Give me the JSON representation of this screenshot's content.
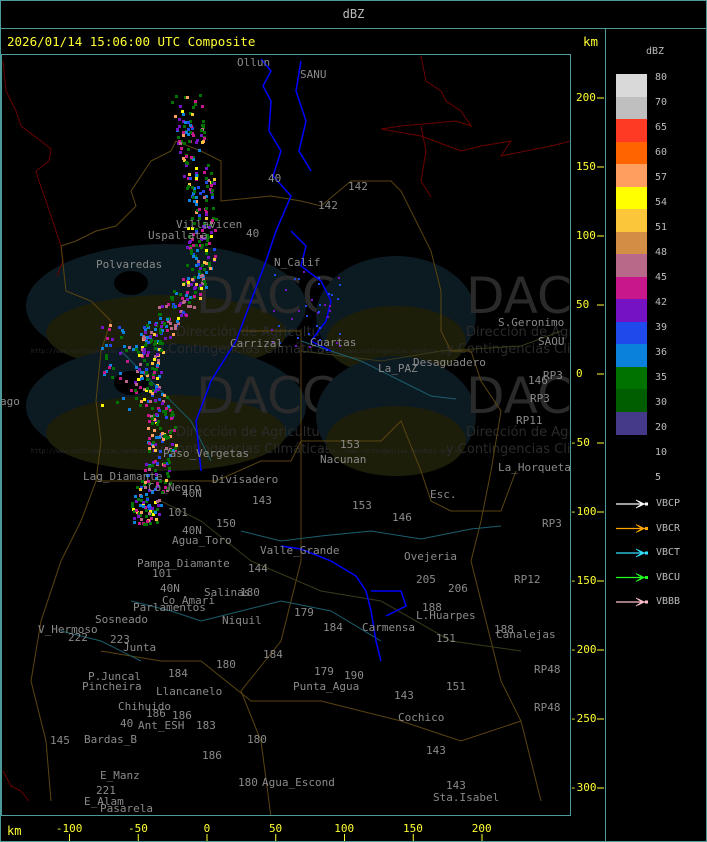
{
  "header": {
    "title": "dBZ"
  },
  "map": {
    "title": "2026/01/14 15:06:00 UTC Composite",
    "unit_top": "km",
    "unit_bottom": "km",
    "x_ticks": [
      "-100",
      "-50",
      "0",
      "50",
      "100",
      "150",
      "200"
    ],
    "y_ticks": [
      "200",
      "150",
      "100",
      "50",
      "0",
      "-50",
      "-100",
      "-150",
      "-200",
      "-250",
      "-300"
    ],
    "watermark": {
      "name": "DACC",
      "line1": "Dirección de Agricultura",
      "line2": "y Contingencias Climáticas",
      "url": "http://www.contingencias.mendoza.gov.ar"
    },
    "places": [
      "Ollun",
      "SANU",
      "Uspallata",
      "Villavicen",
      "Polvaredas",
      "N_Calif",
      "142",
      "142",
      "40",
      "40",
      "Carrizal",
      "Cuartas",
      "La_PAZ",
      "Desaguadero",
      "S.Geronimo",
      "SAOU",
      "RP3",
      "146",
      "RP3",
      "RP11",
      "153",
      "Nacunan",
      "La_Horqueta",
      "Esc.",
      "153",
      "146",
      "Divisadero",
      "Co_Negro",
      "Lag_Diamante",
      "Paso_Vergetas",
      "40N",
      "101",
      "143",
      "150",
      "40N",
      "Agua_Toro",
      "Pampa_Diamante",
      "101",
      "Valle_Grande",
      "144",
      "Salinas",
      "180",
      "40N",
      "Co_Amari",
      "Parlamentos",
      "Sosneado",
      "Niquil",
      "179",
      "184",
      "Carmensa",
      "Ovejeria",
      "205",
      "206",
      "188",
      "L.Huarpes",
      "151",
      "188",
      "Canalejas",
      "RP12",
      "RP3",
      "RP48",
      "RP48",
      "V_Hermoso",
      "222",
      "223",
      "Junta",
      "P.Juncal",
      "Pincheira",
      "184",
      "180",
      "184",
      "179",
      "190",
      "Punta_Agua",
      "Llancanelo",
      "151",
      "143",
      "Cochico",
      "Chihuido",
      "186",
      "186",
      "183",
      "40",
      "Ant_ESH",
      "145",
      "Bardas_B",
      "180",
      "186",
      "143",
      "E_Manz",
      "180",
      "Agua_Escond",
      "143",
      "Sta.Isabel",
      "221",
      "E_Alam",
      "Pasarela",
      "ago"
    ]
  },
  "legend": {
    "title": "dBZ",
    "labels": [
      "80",
      "70",
      "65",
      "60",
      "57",
      "54",
      "51",
      "48",
      "45",
      "42",
      "39",
      "36",
      "35",
      "30",
      "20",
      "10",
      "5"
    ],
    "colors": [
      "#d9d9d9",
      "#bfbfbf",
      "#ff3a24",
      "#ff6400",
      "#ff9e5e",
      "#ffff00",
      "#fcc63a",
      "#d18e44",
      "#b8698a",
      "#c7178a",
      "#7412c4",
      "#1f49ea",
      "#0a82dc",
      "#007200",
      "#005e00",
      "#453a8a"
    ],
    "radars": [
      {
        "name": "VBCP",
        "color": "#ffffff"
      },
      {
        "name": "VBCR",
        "color": "#ffa500"
      },
      {
        "name": "VBCT",
        "color": "#33e0ff"
      },
      {
        "name": "VBCU",
        "color": "#22ff22"
      },
      {
        "name": "VBBB",
        "color": "#ffc0cb"
      }
    ]
  }
}
